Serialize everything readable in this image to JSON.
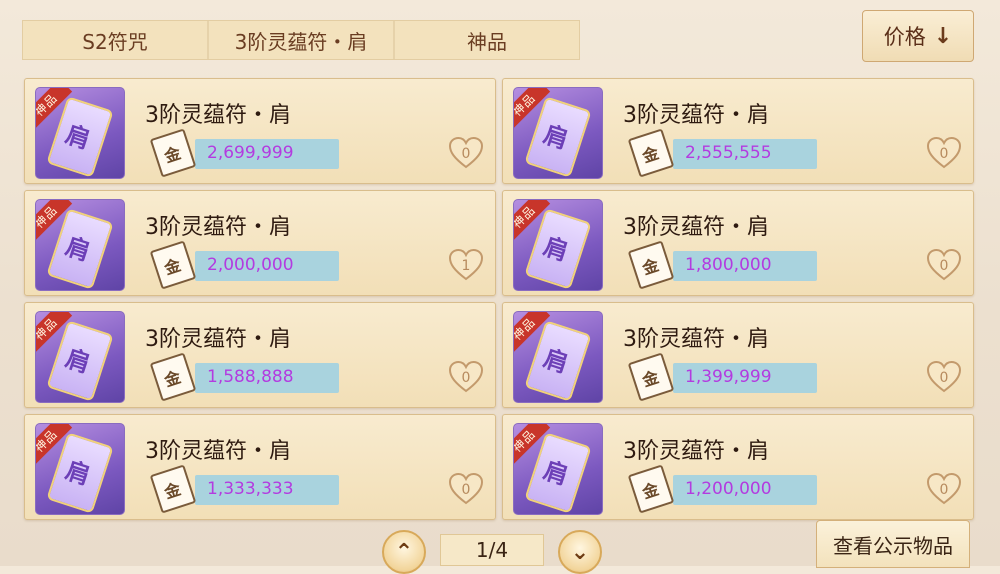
{
  "filters": [
    "S2符咒",
    "3阶灵蕴符・肩",
    "神品"
  ],
  "sort": {
    "label": "价格",
    "icon": "arrow-down-icon"
  },
  "listings": [
    {
      "grade": "神品",
      "name": "3阶灵蕴符・肩",
      "price": "2,699,999",
      "favorites": "0"
    },
    {
      "grade": "神品",
      "name": "3阶灵蕴符・肩",
      "price": "2,555,555",
      "favorites": "0"
    },
    {
      "grade": "神品",
      "name": "3阶灵蕴符・肩",
      "price": "2,000,000",
      "favorites": "1"
    },
    {
      "grade": "神品",
      "name": "3阶灵蕴符・肩",
      "price": "1,800,000",
      "favorites": "0"
    },
    {
      "grade": "神品",
      "name": "3阶灵蕴符・肩",
      "price": "1,588,888",
      "favorites": "0"
    },
    {
      "grade": "神品",
      "name": "3阶灵蕴符・肩",
      "price": "1,399,999",
      "favorites": "0"
    },
    {
      "grade": "神品",
      "name": "3阶灵蕴符・肩",
      "price": "1,333,333",
      "favorites": "0"
    },
    {
      "grade": "神品",
      "name": "3阶灵蕴符・肩",
      "price": "1,200,000",
      "favorites": "0"
    }
  ],
  "pagination": {
    "page_label": "1/4",
    "prev_icon": "chevron-up-icon",
    "next_icon": "chevron-down-icon"
  },
  "public_items_button": "查看公示物品",
  "colors": {
    "price_text": "#b33be0",
    "price_bar": "#a9d3de",
    "grade_ribbon": "#c8352a"
  }
}
